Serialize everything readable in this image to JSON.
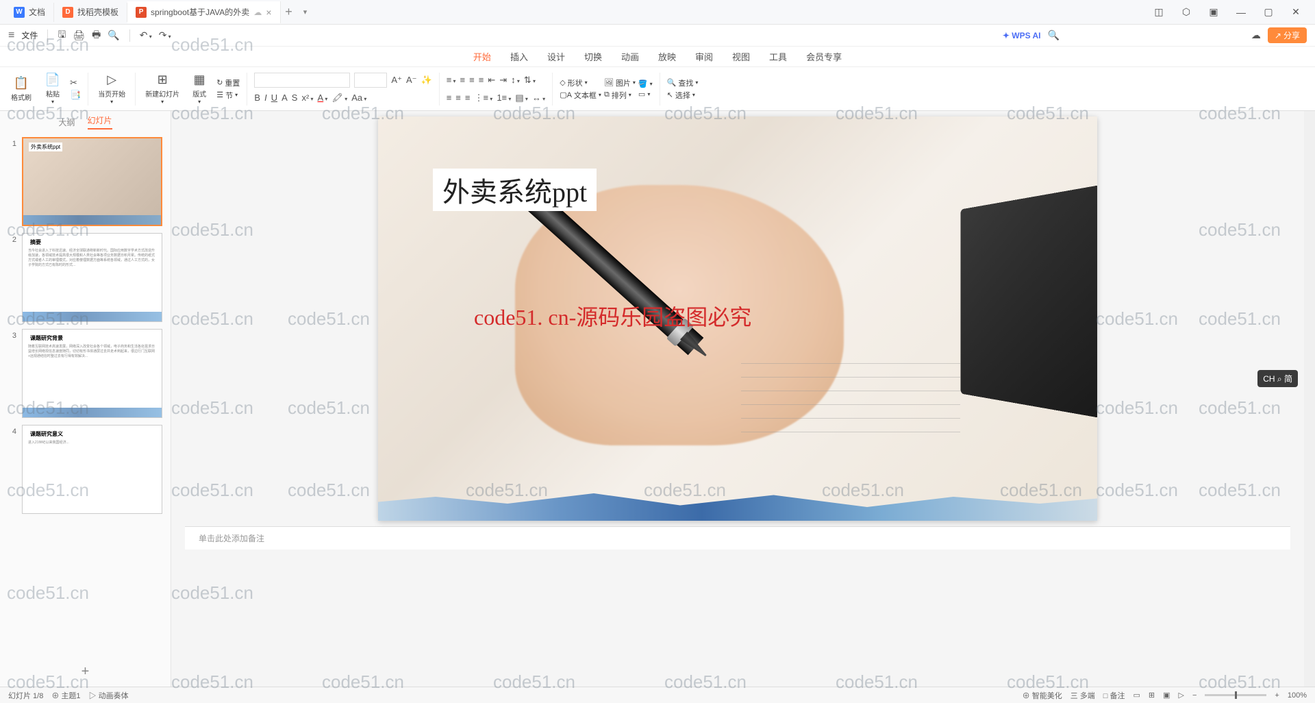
{
  "tabs": [
    {
      "icon": "W",
      "label": "文档",
      "color": "blue"
    },
    {
      "icon": "D",
      "label": "找稻壳模板",
      "color": "orange"
    },
    {
      "icon": "P",
      "label": "springboot基于JAVA的外卖",
      "color": "red"
    }
  ],
  "file_menu": "文件",
  "menu": {
    "items": [
      "开始",
      "插入",
      "设计",
      "切换",
      "动画",
      "放映",
      "审阅",
      "视图",
      "工具",
      "会员专享"
    ],
    "active": 0
  },
  "wps_ai": "WPS AI",
  "share": "分享",
  "ribbon": {
    "fmt": "格式刷",
    "paste": "粘贴",
    "start": "当页开始",
    "newslide": "新建幻灯片",
    "layout": "版式",
    "reset": "重置",
    "section": "节",
    "shape": "形状",
    "picture": "图片",
    "textbox": "文本框",
    "arrange": "排列",
    "find": "查找",
    "select": "选择"
  },
  "left_tabs": {
    "outline": "大纲",
    "slides": "幻灯片"
  },
  "thumbs": [
    {
      "n": "1",
      "title": "外卖系统ppt"
    },
    {
      "n": "2",
      "title": "摘要"
    },
    {
      "n": "3",
      "title": "课题研究背景"
    },
    {
      "n": "4",
      "title": "课题研究意义"
    }
  ],
  "slide": {
    "title": "外卖系统ppt",
    "watermark": "code51. cn-源码乐园盗图必究"
  },
  "notes_placeholder": "单击此处添加备注",
  "status": {
    "slide": "幻灯片 1/8",
    "theme": "⊕ 主题1",
    "anim": "▷ 动画奏体",
    "smart": "⊕ 智能美化",
    "services": "三 多端",
    "voice": "□ 备注",
    "zoom": "100%"
  },
  "ime": "CH ⌕ 简",
  "wm_text": "code51.cn"
}
